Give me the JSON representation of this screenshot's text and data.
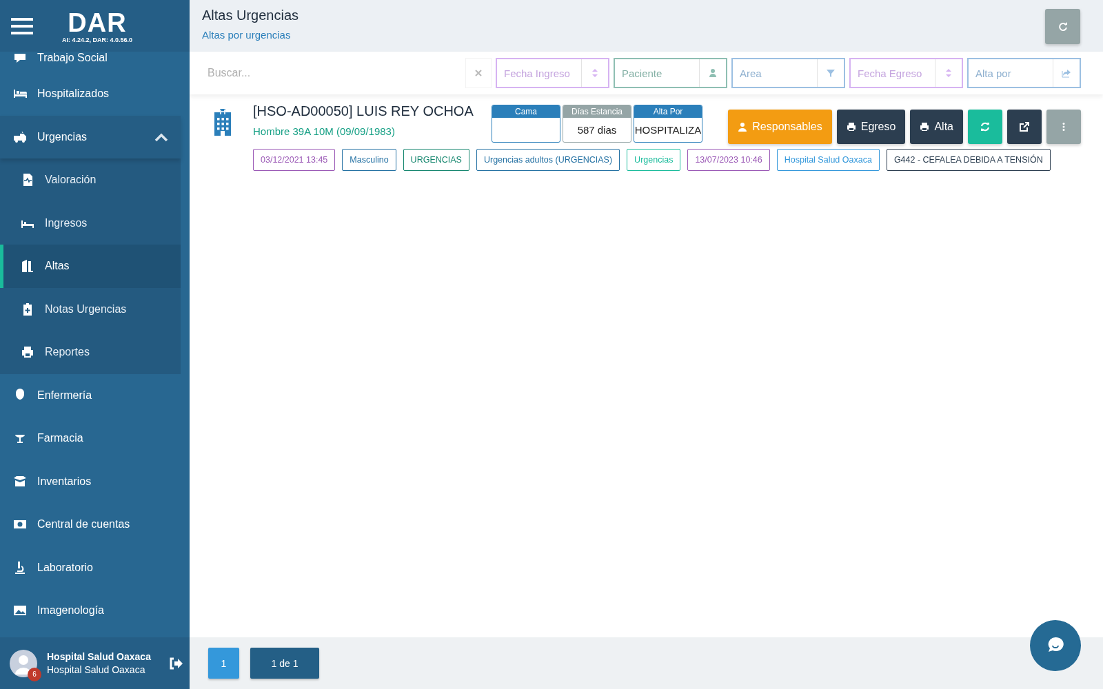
{
  "sidebar": {
    "logo": "DAR",
    "version": "AI: 4.24.2, DAR: 4.0.56.0",
    "items": [
      {
        "label": "Trabajo Social",
        "expanded": false
      },
      {
        "label": "Hospitalizados",
        "expanded": false
      },
      {
        "label": "Urgencias",
        "expanded": true,
        "children": [
          {
            "label": "Valoración",
            "selected": false
          },
          {
            "label": "Ingresos",
            "selected": false
          },
          {
            "label": "Altas",
            "selected": true
          },
          {
            "label": "Notas Urgencias",
            "selected": false
          },
          {
            "label": "Reportes",
            "selected": false
          }
        ]
      },
      {
        "label": "Enfermería",
        "expanded": false
      },
      {
        "label": "Farmacia",
        "expanded": false
      },
      {
        "label": "Inventarios",
        "expanded": false
      },
      {
        "label": "Central de cuentas",
        "expanded": false
      },
      {
        "label": "Laboratorio",
        "expanded": false
      },
      {
        "label": "Imagenología",
        "expanded": false
      }
    ],
    "user": {
      "name": "Hospital Salud Oaxaca",
      "organization": "Hospital Salud Oaxaca",
      "badge": "6"
    }
  },
  "header": {
    "title": "Altas Urgencias",
    "subtitle": "Altas por urgencias"
  },
  "filters": {
    "search": {
      "placeholder": "Buscar..."
    },
    "items": [
      {
        "placeholder": "Fecha Ingreso",
        "color": "#d6b3f2"
      },
      {
        "placeholder": "Paciente",
        "color": "#8fbfb3"
      },
      {
        "placeholder": "Area",
        "color": "#9cc0e2"
      },
      {
        "placeholder": "Fecha Egreso",
        "color": "#d6b3f2"
      },
      {
        "placeholder": "Alta por",
        "color": "#9cc0e2"
      }
    ]
  },
  "record": {
    "name": "[HSO-AD00050] LUIS REY OCHOA",
    "details": "Hombre 39A 10M (09/09/1983)",
    "info": [
      {
        "label": "Cama",
        "color": "#2b7fba"
      },
      {
        "label": "Días Estancia",
        "value": "587 dias",
        "color": "#95a5a6"
      },
      {
        "label": "Alta Por",
        "value": "HOSPITALIZA",
        "color": "#2b7fba"
      }
    ],
    "actions": [
      {
        "label": "Responsables",
        "color": "#f39c12"
      },
      {
        "label": "Egreso",
        "color": "#2c3e50"
      },
      {
        "label": "Alta",
        "color": "#2c3e50"
      },
      {
        "color": "#1abc9c"
      },
      {
        "color": "#2c3e50"
      },
      {
        "color": "#95a5a6"
      }
    ],
    "tags": [
      {
        "label": "03/12/2021 13:45",
        "color": "#9b59b6"
      },
      {
        "label": "Masculino",
        "color": "#2471a3"
      },
      {
        "label": "URGENCIAS",
        "color": "#16876f"
      },
      {
        "label": "Urgencias adultos (URGENCIAS)",
        "color": "#2471a3"
      },
      {
        "label": "Urgencias",
        "color": "#1abc9c"
      },
      {
        "label": "13/07/2023 10:46",
        "color": "#9b59b6"
      },
      {
        "label": "Hospital Salud Oaxaca",
        "color": "#3498db"
      },
      {
        "label": "G442 - CEFALEA DEBIDA A TENSIÓN",
        "color": "#2c3e50"
      }
    ]
  },
  "pagination": {
    "pages": [
      {
        "label": "1",
        "selected": true
      }
    ],
    "summary": "1 de 1"
  }
}
